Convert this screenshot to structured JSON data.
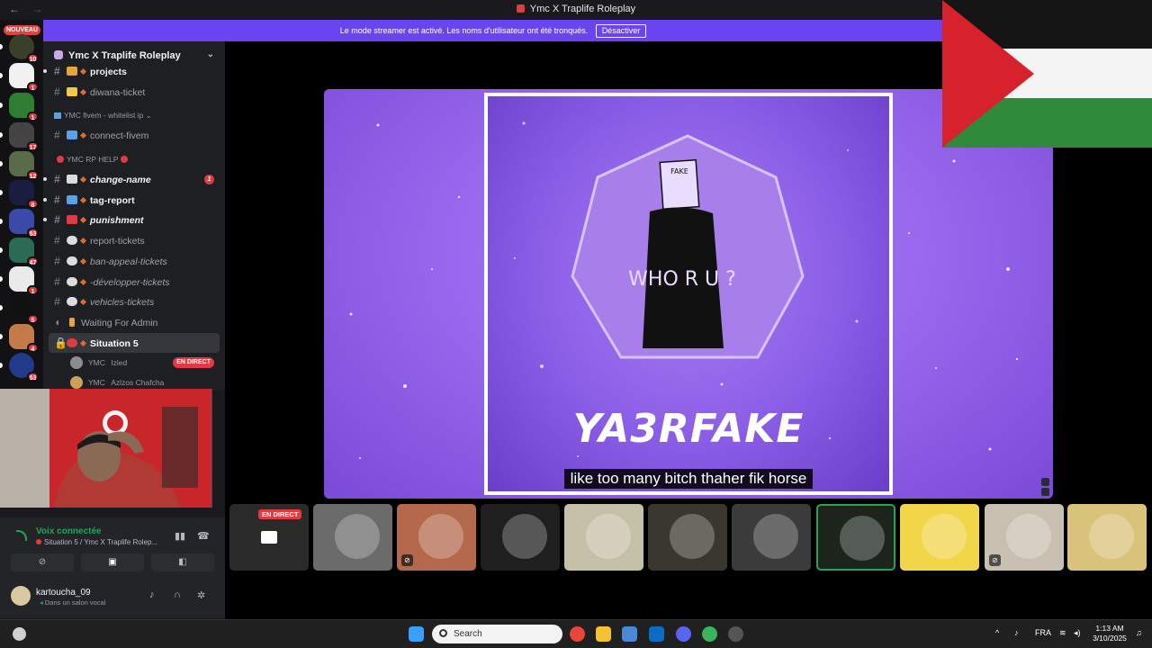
{
  "window": {
    "title": "Ymc X Traplife Roleplay",
    "nav_back": "←",
    "nav_forward": "→"
  },
  "banner": {
    "text": "Le mode streamer est activé. Les noms d'utilisateur ont été tronqués.",
    "button": "Désactiver"
  },
  "rail": {
    "new_label": "NOUVEAU",
    "servers": [
      {
        "badge": "10",
        "color": "#3a3f2a"
      },
      {
        "badge": "1",
        "color": "#f1f1f1"
      },
      {
        "badge": "1",
        "color": "#2e7d32"
      },
      {
        "badge": "17",
        "color": "#444"
      },
      {
        "badge": "12",
        "color": "#5a6b4a"
      },
      {
        "badge": "8",
        "color": "#1b1d40"
      },
      {
        "badge": "53",
        "color": "#3b4aa8"
      },
      {
        "badge": "47",
        "color": "#2b6b55"
      },
      {
        "badge": "1",
        "color": "#eaeaea"
      },
      {
        "badge": "5",
        "color": "#111"
      },
      {
        "badge": "4",
        "color": "#c47b4a"
      },
      {
        "badge": "53",
        "color": "#223a88"
      }
    ]
  },
  "server": {
    "name": "Ymc X Traplife Roleplay",
    "chevron": "⌄"
  },
  "channels": {
    "top": [
      {
        "name": "projects",
        "icon_color": "#e8a33a"
      },
      {
        "name": "diwana-ticket",
        "icon_color": "#f2c94c"
      }
    ],
    "cat1": {
      "name": "YMC fivem - whitelist ip",
      "chevron": "⌄"
    },
    "cat1_items": [
      {
        "name": "connect-fivem",
        "icon_color": "#5aa0e6"
      }
    ],
    "cat2": {
      "name": "YMC RP HELP"
    },
    "cat2_items": [
      {
        "name": "change-name",
        "icon_color": "#dcdcdc",
        "unread": "1"
      },
      {
        "name": "tag-report",
        "icon_color": "#5aa0e6"
      },
      {
        "name": "punishment",
        "icon_color": "#e03b44"
      },
      {
        "name": "report-tickets",
        "icon_color": "#dcdcdc"
      },
      {
        "name": "ban-appeal-tickets",
        "icon_color": "#dcdcdc"
      },
      {
        "name": "-développer-tickets",
        "icon_color": "#dcdcdc"
      },
      {
        "name": "vehicles-tickets",
        "icon_color": "#dcdcdc"
      },
      {
        "name": "Waiting For Admin",
        "icon_color": "#e8a33a"
      },
      {
        "name": "Situation 5",
        "icon_color": "#e03b44"
      }
    ],
    "voice_users": [
      {
        "prefix": "YMC",
        "name": "Izled",
        "live": "EN DIRECT"
      },
      {
        "prefix": "YMC",
        "name": "Azlzos Chafcha"
      }
    ]
  },
  "voice": {
    "status": "Voix connectée",
    "location": "Situation 5 / Ymc X Traplife Rolep...",
    "username": "kartoucha_09",
    "user_status": "Dans un salon vocal"
  },
  "stream": {
    "headline": "YA3RFAKE",
    "art_tag": "FAKE",
    "art_text": "WHO R U ?",
    "subtitle": "like too many bitch thaher fik horse"
  },
  "participants": [
    {
      "bg": "#2a2a2a",
      "live": "EN DIRECT"
    },
    {
      "bg": "#6b6b6b"
    },
    {
      "bg": "#b4694c",
      "muted": true
    },
    {
      "bg": "#1f1f1f"
    },
    {
      "bg": "#c7c0a8"
    },
    {
      "bg": "#3a382e"
    },
    {
      "bg": "#3b3b3b"
    },
    {
      "bg": "#1c241c",
      "speaking": true
    },
    {
      "bg": "#f2d64a"
    },
    {
      "bg": "#c9bfb1",
      "muted": true
    },
    {
      "bg": "#d9c27a"
    }
  ],
  "taskbar": {
    "search_placeholder": "Search",
    "lang": "FRA",
    "time": "1:13 AM",
    "date": "3/10/2025"
  }
}
